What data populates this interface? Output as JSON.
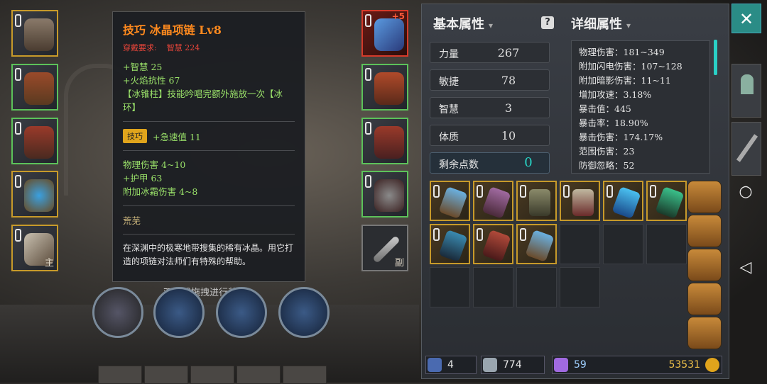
{
  "tooltip": {
    "title": "技巧 冰晶项链 Lv8",
    "requirement_label": "穿戴要求:",
    "requirement_value": "智慧 224",
    "bonus_lines": [
      "+智慧 25",
      "+火焰抗性 67",
      "【冰锥柱】技能吟唱完额外施放一次【冰环】"
    ],
    "skill_chip": "技巧",
    "skill_bonus": "+急速值 11",
    "base_lines": [
      "物理伤害 4~10",
      "+护甲 63",
      "附加冰霜伤害 4~8"
    ],
    "set_name": "荒芜",
    "description": "在深渊中的极寒地带搜集的稀有冰晶。用它打造的项链对法师们有特殊的帮助。"
  },
  "hint": "双击或拖拽进行装备",
  "equipment": {
    "slot_main_tag": "主",
    "slot_off_tag": "副",
    "necklace_badge": "+5"
  },
  "basic": {
    "header": "基本属性",
    "stats": [
      {
        "label": "力量",
        "value": "267"
      },
      {
        "label": "敏捷",
        "value": "78"
      },
      {
        "label": "智慧",
        "value": "3"
      },
      {
        "label": "体质",
        "value": "10"
      }
    ],
    "remaining_label": "剩余点数",
    "remaining_value": "0"
  },
  "detail": {
    "header": "详细属性",
    "lines": [
      "物理伤害：181~349",
      "附加闪电伤害：107~128",
      "附加暗影伤害：11~11",
      "增加攻速：3.18%",
      "暴击值：445",
      "暴击率：18.90%",
      "暴击伤害：174.17%",
      "范围伤害：23",
      "防御忽略：52"
    ]
  },
  "resources": {
    "keys": "4",
    "shards": "774",
    "gems": "59",
    "gold": "53531"
  },
  "icons": {
    "close": "✕",
    "help": "?"
  }
}
